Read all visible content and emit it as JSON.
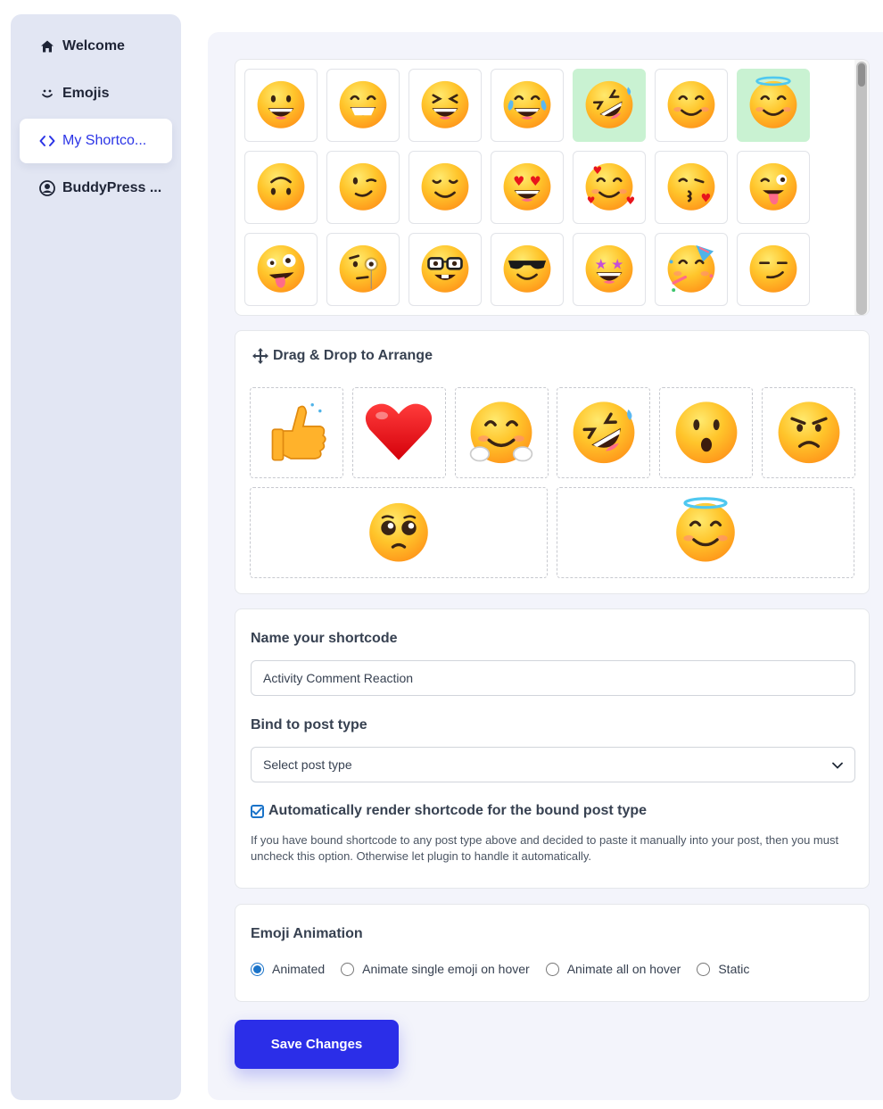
{
  "sidebar": {
    "items": [
      {
        "label": "Welcome",
        "icon": "home-icon"
      },
      {
        "label": "Emojis",
        "icon": "smile-icon"
      },
      {
        "label": "My Shortco...",
        "icon": "code-icon"
      },
      {
        "label": "BuddyPress ...",
        "icon": "buddypress-icon"
      }
    ],
    "active_index": 2
  },
  "picker": {
    "rows": [
      [
        "grinning-face-with-big-eyes",
        "beaming-face",
        "grinning-squinting-face",
        "face-with-tears-of-joy",
        "rolling-on-floor-laughing",
        "smiling-face",
        "smiling-face-with-halo"
      ],
      [
        "upside-down-face",
        "winking-face",
        "relieved-face",
        "smiling-face-with-heart-eyes",
        "smiling-face-with-hearts",
        "face-blowing-kiss",
        "winking-face-with-tongue"
      ],
      [
        "zany-face",
        "face-with-monocle",
        "nerd-face",
        "smiling-face-with-sunglasses",
        "star-struck",
        "partying-face",
        "smirking-face"
      ]
    ],
    "selected": [
      "rolling-on-floor-laughing",
      "smiling-face-with-halo"
    ]
  },
  "arrange": {
    "title": "Drag & Drop to Arrange",
    "row1": [
      "thumbs-up",
      "red-heart",
      "hugging-face",
      "rolling-on-floor-laughing",
      "hushed-face",
      "angry-face"
    ],
    "row2": [
      "pleading-face",
      "smiling-face-with-halo"
    ]
  },
  "settings": {
    "name_label": "Name your shortcode",
    "name_value": "Activity Comment Reaction",
    "post_type_label": "Bind to post type",
    "post_type_value": "Select post type",
    "auto_render_label": "Automatically render shortcode for the bound post type",
    "auto_render_checked": true,
    "help_text": "If you have bound shortcode to any post type above and decided to paste it manually into your post, then you must uncheck this option. Otherwise let plugin to handle it automatically."
  },
  "animation": {
    "title": "Emoji Animation",
    "options": [
      "Animated",
      "Animate single emoji on hover",
      "Animate all on hover",
      "Static"
    ],
    "selected_index": 0
  },
  "save_label": "Save Changes",
  "colors": {
    "accent": "#2b2ee8",
    "sidebar_bg": "#e2e6f3",
    "selected_cell": "#c9f2d2"
  }
}
